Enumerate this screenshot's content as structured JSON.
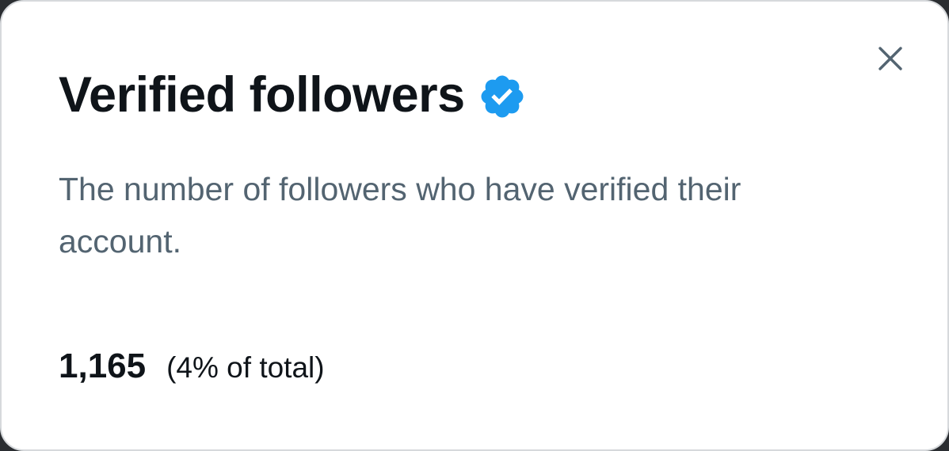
{
  "dialog": {
    "title": "Verified followers",
    "verified_icon": "verified-badge-icon",
    "close_icon": "close-icon",
    "description": "The number of followers who have verified their account.",
    "stat_value": "1,165",
    "stat_share": "(4% of total)"
  },
  "colors": {
    "badge": "#1d9bf0",
    "title_text": "#0f1419",
    "secondary_text": "#536471",
    "close_icon": "#536471",
    "background": "#ffffff"
  }
}
